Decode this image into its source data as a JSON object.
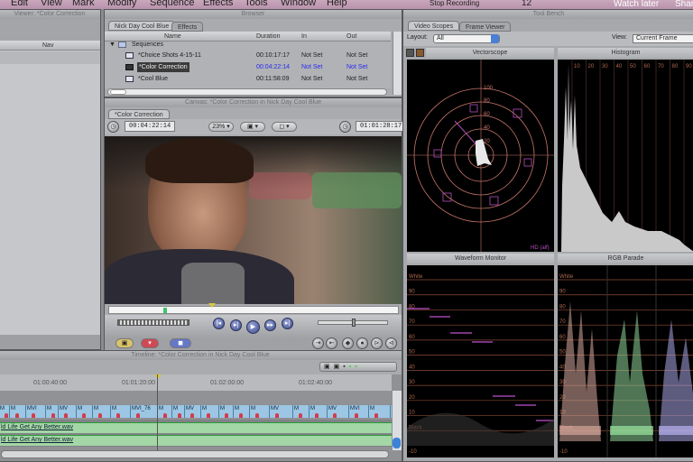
{
  "menubar": {
    "items": [
      "Edit",
      "View",
      "Mark",
      "Modify",
      "Sequence",
      "Effects",
      "Tools",
      "Window",
      "Help"
    ],
    "stop_recording": "Stop Recording",
    "badge": "12",
    "watch_later": "Watch later",
    "share": "Shar"
  },
  "viewer": {
    "title": "Viewer: *Color Correction",
    "nav_label": "Nav"
  },
  "browser": {
    "title": "Browser",
    "tabs": [
      "Nick Day Cool Blue",
      "Effects"
    ],
    "columns": [
      "Name",
      "Duration",
      "In",
      "Out"
    ],
    "folder": "Sequences",
    "rows": [
      {
        "name": "*Choice Shots 4-15-11",
        "duration": "00:10:17:17",
        "in": "Not Set",
        "out": "Not Set",
        "selected": false
      },
      {
        "name": "*Color Correction",
        "duration": "00:04:22:14",
        "in": "Not Set",
        "out": "Not Set",
        "selected": true
      },
      {
        "name": "*Cool Blue",
        "duration": "00:11:58:09",
        "in": "Not Set",
        "out": "Not Set",
        "selected": false
      }
    ]
  },
  "canvas": {
    "title": "Canvas: *Color Correction in Nick Day Cool Blue",
    "tab": "*Color Correction",
    "duration_tc": "00:04:22:14",
    "zoom": "23%",
    "current_tc": "01:01:28:17"
  },
  "timeline": {
    "title": "Timeline: *Color Correction in Nick Day Cool Blue",
    "ruler": [
      "01:00:40:00",
      "01:01:20:00",
      "01:02:00:00",
      "01:02:40:00"
    ],
    "clips": [
      "M",
      "M",
      "MVI",
      "M",
      "MV",
      "M",
      "M",
      "M",
      "MVI_76",
      "M",
      "M",
      "MV",
      "M",
      "M",
      "M",
      "M",
      "MV",
      "M",
      "M",
      "MV",
      "MVI",
      "M"
    ],
    "audio_tracks": [
      "ld Life Get Any Better.wav",
      "ld Life Get Any Better.wav"
    ]
  },
  "toolbench": {
    "title": "Tool Bench",
    "tabs": [
      "Video Scopes",
      "Frame Viewer"
    ],
    "layout_label": "Layout:",
    "layout_value": "All",
    "view_label": "View:",
    "view_value": "Current Frame",
    "scopes": {
      "vectorscope": "Vectorscope",
      "histogram": "Histogram",
      "waveform": "Waveform Monitor",
      "parade": "RGB Parade"
    },
    "vector_rings": [
      "100",
      "80",
      "60",
      "40",
      "20"
    ],
    "histogram_ticks": [
      "10",
      "20",
      "30",
      "40",
      "50",
      "60",
      "70",
      "80",
      "90"
    ],
    "waveform_ticks": [
      "White",
      "90",
      "80",
      "70",
      "60",
      "50",
      "40",
      "30",
      "20",
      "10",
      "Black",
      "-10"
    ],
    "hd_label": "HD (alf)"
  }
}
